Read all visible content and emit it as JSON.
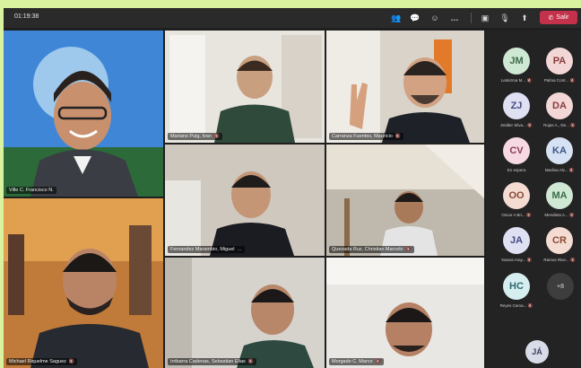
{
  "meeting": {
    "timer": "01:19:38",
    "leave_label": "Salir",
    "toolbar_icons": [
      "people-icon",
      "chat-icon",
      "reactions-icon",
      "more-icon",
      "camera-off-icon",
      "mic-icon",
      "share-icon"
    ]
  },
  "tiles": [
    {
      "name": "Ville C. Francisco N.",
      "speaking": true
    },
    {
      "name": "Mariano Puig, Ivan",
      "speaking": true
    },
    {
      "name": "Carranza Fuentes, Mauricio",
      "speaking": false
    },
    {
      "name": "Fernandez Marambio, Miguel",
      "speaking": false
    },
    {
      "name": "Quezada Ruz, Christian Marcelo",
      "speaking": false
    },
    {
      "name": "Michael Riquelme Saguez",
      "speaking": false
    },
    {
      "name": "Irribarra Cadenas, Sebastian Elias",
      "speaking": false
    },
    {
      "name": "Morgado C. Marco",
      "speaking": false
    }
  ],
  "roster": [
    {
      "initials": "JM",
      "name": "Ledezma M...",
      "bg": "#cfe8d4",
      "fg": "#3b6b47"
    },
    {
      "initials": "PA",
      "name": "Palma Cont...",
      "bg": "#f3d6d6",
      "fg": "#8a3b3b"
    },
    {
      "initials": "ZJ",
      "name": "Zeidler Silva...",
      "bg": "#dfe0f2",
      "fg": "#454a80"
    },
    {
      "initials": "DA",
      "name": "Rojas A., De...",
      "bg": "#f3d6d6",
      "fg": "#8a3b3b"
    },
    {
      "initials": "CV",
      "name": "En espera",
      "bg": "#f6d9e3",
      "fg": "#8e3b5a"
    },
    {
      "initials": "KA",
      "name": "Medina Alv...",
      "bg": "#d6e2f3",
      "fg": "#3b5886"
    },
    {
      "initials": "OO",
      "name": "Oscar A Bri...",
      "bg": "#f4dcd3",
      "fg": "#8a4a33"
    },
    {
      "initials": "MA",
      "name": "Mendieta A...",
      "bg": "#cfe8d4",
      "fg": "#3b6b47"
    },
    {
      "initials": "JA",
      "name": "Yavara Aray...",
      "bg": "#dfe0f2",
      "fg": "#454a80"
    },
    {
      "initials": "CR",
      "name": "Ramos Rive...",
      "bg": "#f4dcd3",
      "fg": "#8a4a33"
    },
    {
      "initials": "HC",
      "name": "Reyes Carva...",
      "bg": "#d6eef0",
      "fg": "#2f6a70"
    }
  ],
  "overflow_count": "+8",
  "self_initials": "JÁ"
}
